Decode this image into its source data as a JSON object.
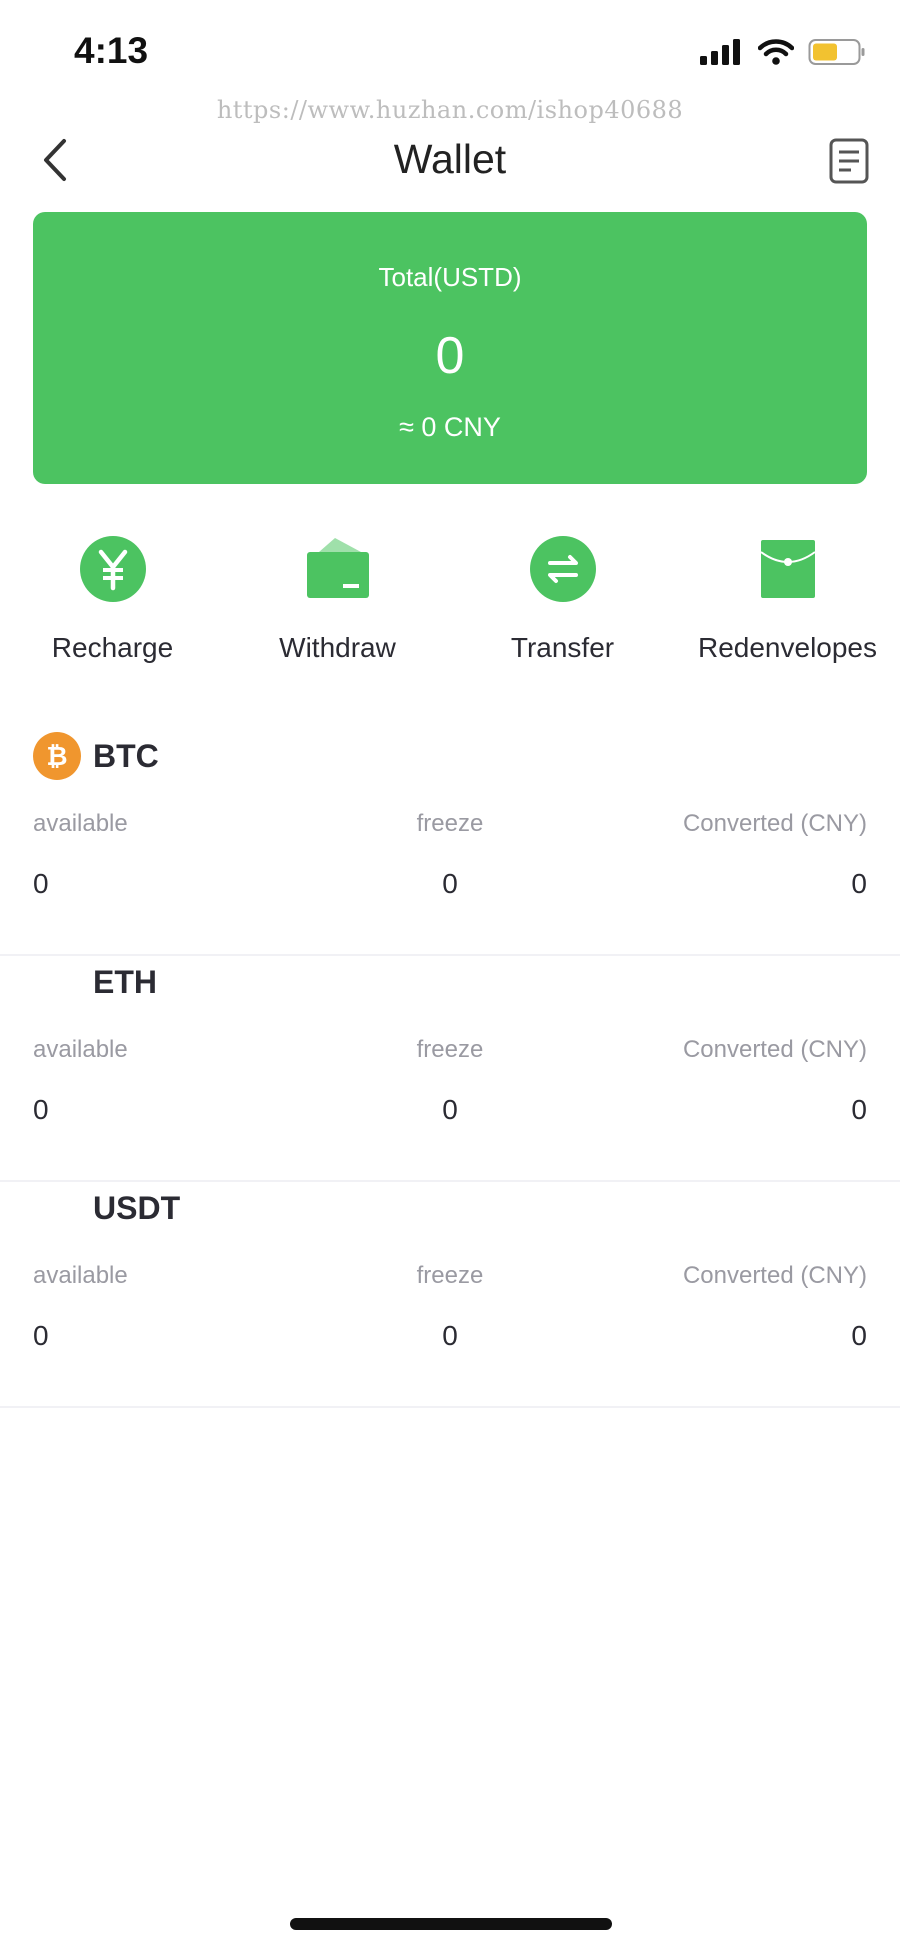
{
  "status_bar": {
    "time": "4:13"
  },
  "watermark": "https://www.huzhan.com/ishop40688",
  "header": {
    "title": "Wallet",
    "back_icon": "chevron-left-icon",
    "records_icon": "document-list-icon"
  },
  "total": {
    "label": "Total(USTD)",
    "value": "0",
    "cny": "≈ 0 CNY"
  },
  "colors": {
    "accent": "#4cc361",
    "btc": "#f0962e",
    "text": "#2b2b33",
    "muted": "#9a9aa2"
  },
  "actions": [
    {
      "label": "Recharge",
      "icon": "yuan-circle-icon"
    },
    {
      "label": "Withdraw",
      "icon": "wallet-icon"
    },
    {
      "label": "Transfer",
      "icon": "transfer-arrows-icon"
    },
    {
      "label": "Redenvelopes",
      "icon": "red-envelope-icon"
    }
  ],
  "coins": [
    {
      "name": "BTC",
      "icon": "bitcoin-icon",
      "available_label": "available",
      "freeze_label": "freeze",
      "converted_label": "Converted (CNY)",
      "available": "0",
      "freeze": "0",
      "converted": "0"
    },
    {
      "name": "ETH",
      "available_label": "available",
      "freeze_label": "freeze",
      "converted_label": "Converted (CNY)",
      "available": "0",
      "freeze": "0",
      "converted": "0"
    },
    {
      "name": "USDT",
      "available_label": "available",
      "freeze_label": "freeze",
      "converted_label": "Converted (CNY)",
      "available": "0",
      "freeze": "0",
      "converted": "0"
    }
  ]
}
